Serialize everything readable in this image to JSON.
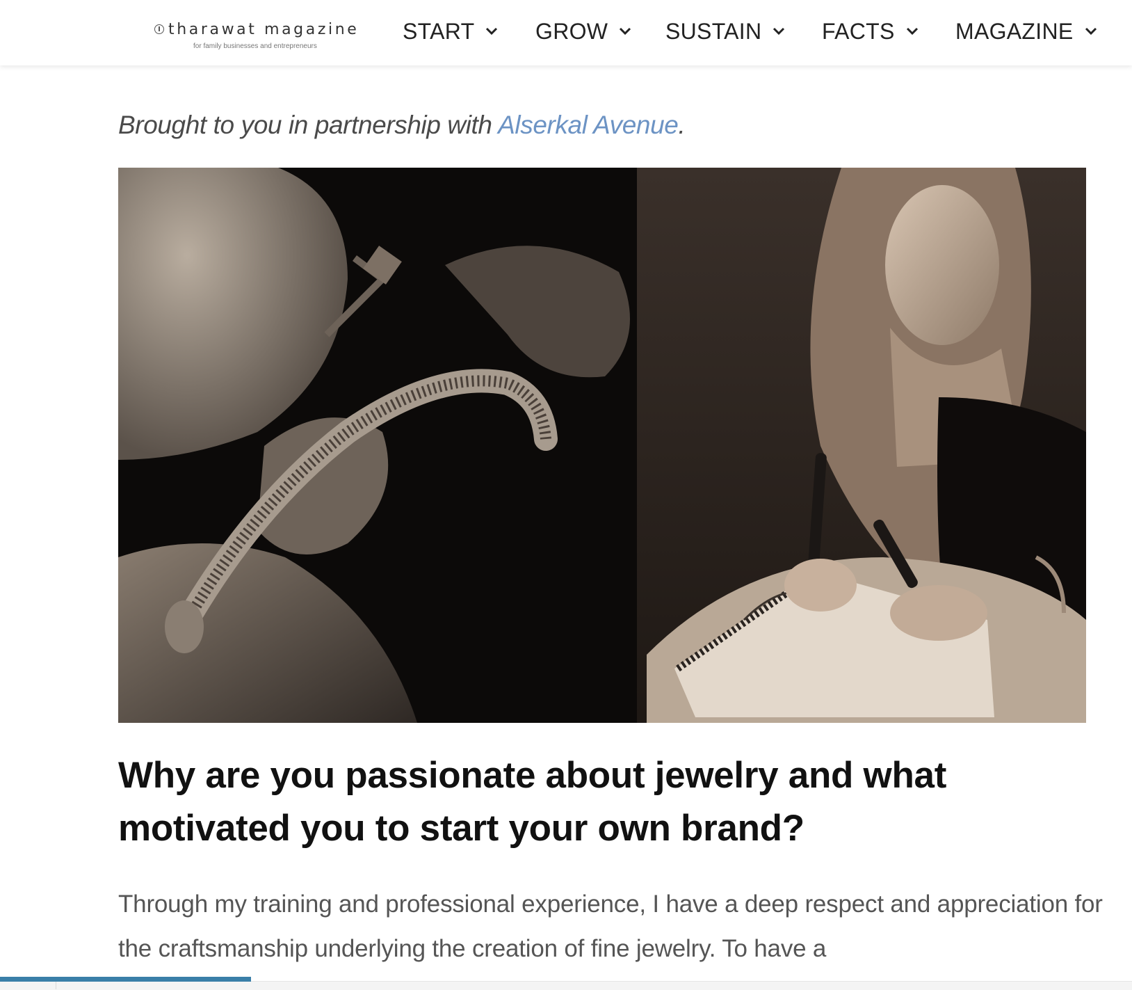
{
  "header": {
    "logo_title": "tharawat magazine",
    "logo_tagline": "for family businesses and entrepreneurs",
    "nav": [
      {
        "label": "START"
      },
      {
        "label": "GROW"
      },
      {
        "label": "SUSTAIN"
      },
      {
        "label": "FACTS"
      },
      {
        "label": "MAGAZINE"
      }
    ]
  },
  "article": {
    "partner_prefix": "Brought to you in partnership with ",
    "partner_link": "Alserkal Avenue",
    "partner_suffix": ".",
    "heading": "Why are you passionate about jewelry and what motivated you to start your own brand?",
    "body": "Through my training and professional experience, I have a deep respect and appreciation for the craftsmanship underlying the creation of fine jewelry. To have a"
  },
  "reading_progress": 0.222,
  "colors": {
    "link": "#6c93c4",
    "progress": "#3a7fa8"
  },
  "icons": {
    "nav_dropdown": "chevron-down-icon"
  }
}
